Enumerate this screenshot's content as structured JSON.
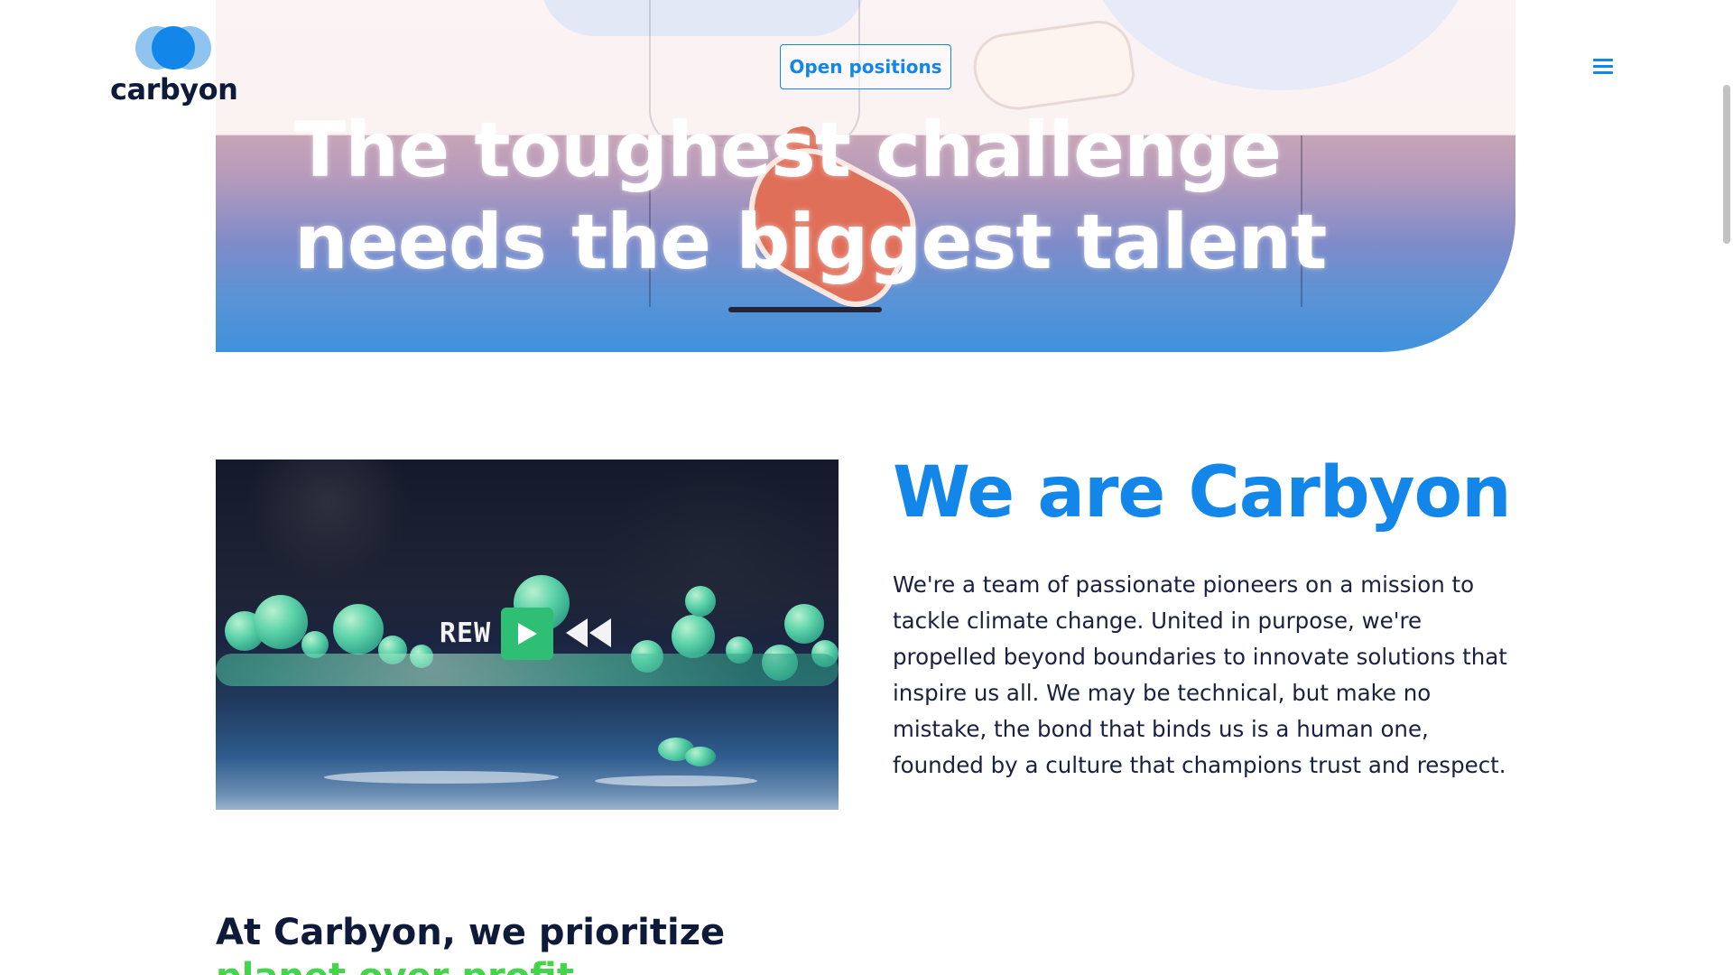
{
  "brand": {
    "name": "carbyon",
    "logo_colors": [
      "#8fc4ef",
      "#1387e9"
    ]
  },
  "header": {
    "open_positions_label": "Open positions",
    "menu_icon": "hamburger-menu-icon"
  },
  "hero": {
    "title_line1": "The toughest challenge",
    "title_line2": "needs the biggest talent"
  },
  "video": {
    "rew_label": "REW",
    "play_icon": "play-icon",
    "rewind_icon": "rewind-icon"
  },
  "intro": {
    "heading": "We are Carbyon",
    "body": "We're a team of passionate pioneers on a mission to tackle climate change. United in purpose, we're propelled beyond boundaries to innovate solutions that inspire us all. We may be technical, but make no mistake, the bond that binds us is a human one, founded by a culture that champions trust and respect."
  },
  "prioritize": {
    "heading": "At Carbyon, we prioritize",
    "subheading": "planet over profit"
  },
  "colors": {
    "accent_blue": "#1387e9",
    "accent_green": "#44d64a",
    "navy": "#0e1a3a"
  }
}
